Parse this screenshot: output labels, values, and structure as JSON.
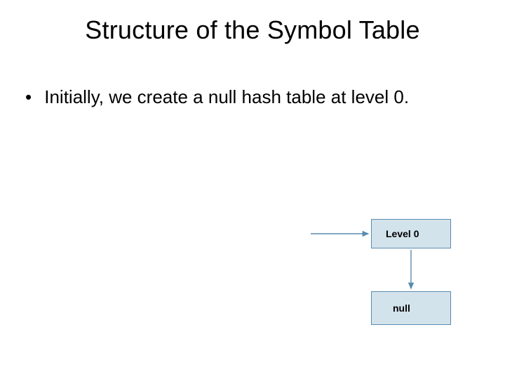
{
  "slide": {
    "title": "Structure of the Symbol Table",
    "bullet": "Initially, we create a null hash table at level 0."
  },
  "diagram": {
    "level_box_label": "Level 0",
    "null_box_label": "null"
  },
  "colors": {
    "box_fill": "#d3e3ec",
    "box_stroke": "#5a8bb0",
    "arrow": "#5a8bb0"
  }
}
